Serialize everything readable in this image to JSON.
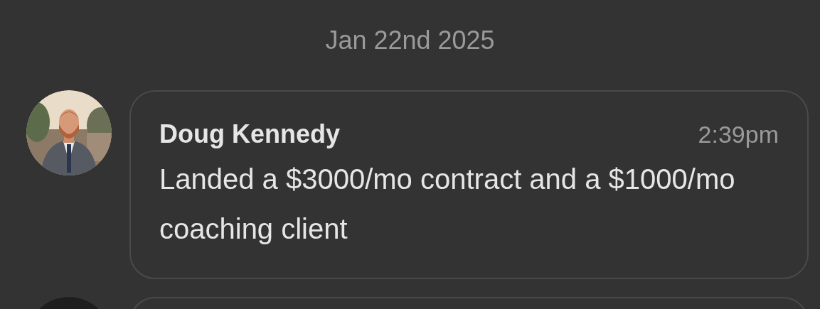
{
  "date_divider": "Jan 22nd 2025",
  "messages": [
    {
      "kind": "full",
      "author": "Doug Kennedy",
      "time": "2:39pm",
      "text": "Landed a $3000/mo contract and a $1000/mo coaching client"
    },
    {
      "kind": "partial"
    }
  ]
}
